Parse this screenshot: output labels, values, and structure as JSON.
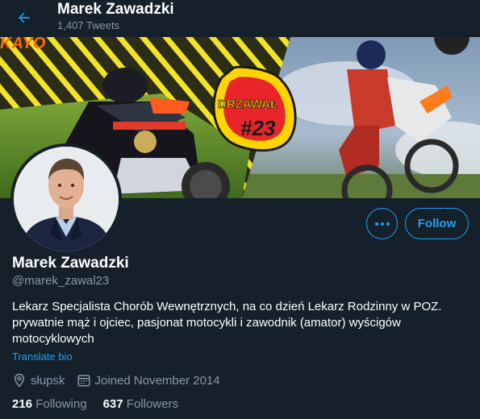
{
  "header": {
    "title": "Marek Zawadzki",
    "tweet_count": "1,407 Tweets"
  },
  "profile": {
    "name": "Marek Zawadzki",
    "handle": "@marek_zawal23",
    "bio_lines": [
      "Lekarz Specjalista Chorób Wewnętrznych, na co dzień Lekarz Rodzinny w POZ.",
      "prywatnie mąż i ojciec, pasjonat motocykli i zawodnik (amator) wyścigów",
      "motocyklowych"
    ],
    "translate_label": "Translate bio",
    "location": "słupsk",
    "joined": "Joined November 2014",
    "following_count": "216",
    "following_label": "Following",
    "followers_count": "637",
    "followers_label": "Followers"
  },
  "actions": {
    "follow_label": "Follow"
  },
  "banner": {
    "logo_text_top": "DRZAWAŁ",
    "logo_text_num": "#23",
    "corner_text": "KAYO"
  },
  "colors": {
    "background": "#15202b",
    "accent": "#1da1f2",
    "secondary_text": "#8899a6"
  }
}
